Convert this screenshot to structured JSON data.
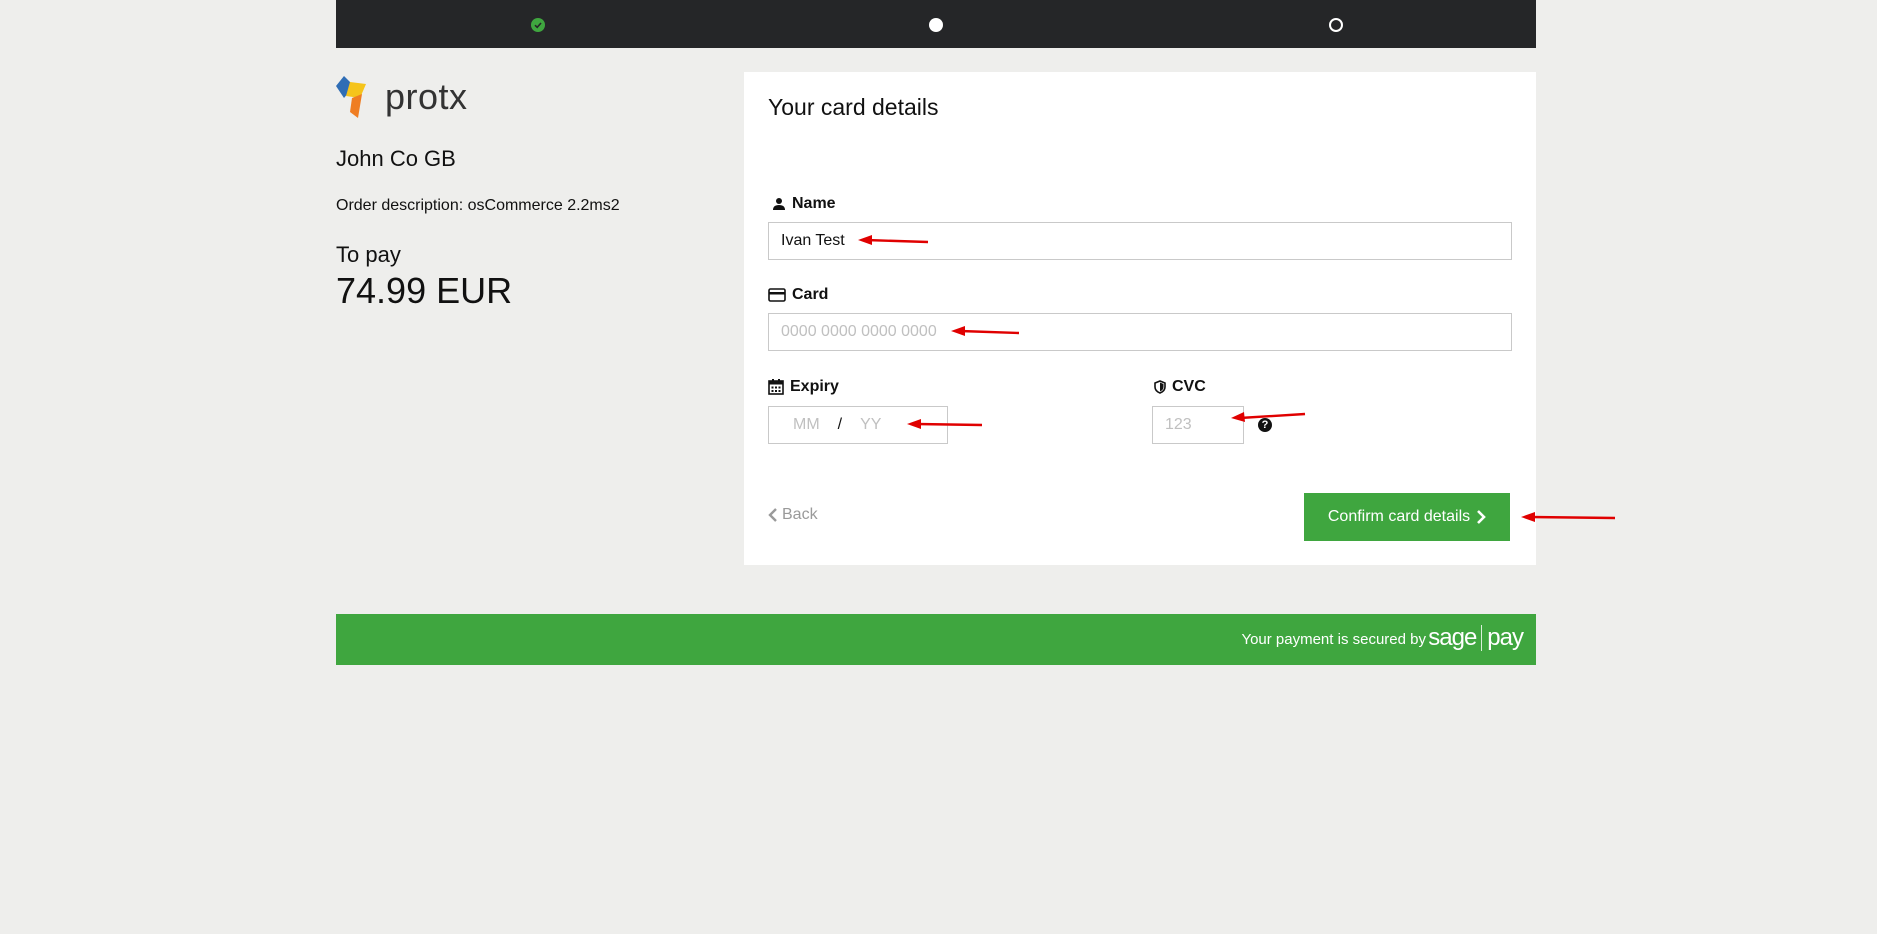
{
  "progress": {
    "steps": [
      {
        "state": "complete",
        "icon": "check-icon"
      },
      {
        "state": "current",
        "icon": "dot-filled-icon"
      },
      {
        "state": "upcoming",
        "icon": "dot-outline-icon"
      }
    ],
    "colors": {
      "complete": "#3fa63f",
      "bar": "#252628"
    }
  },
  "merchant": {
    "logo_text": "protx",
    "name": "John Co GB",
    "order_description": "Order description: osCommerce 2.2ms2",
    "to_pay_label": "To pay",
    "amount": "74.99 EUR"
  },
  "form": {
    "title": "Your card details",
    "name": {
      "label": "Name",
      "icon": "user-icon",
      "value": "Ivan Test"
    },
    "card": {
      "label": "Card",
      "icon": "credit-card-icon",
      "placeholder": "0000 0000 0000 0000"
    },
    "expiry": {
      "label": "Expiry",
      "icon": "calendar-icon",
      "month_placeholder": "MM",
      "separator": "/",
      "year_placeholder": "YY"
    },
    "cvc": {
      "label": "CVC",
      "icon": "shield-icon",
      "placeholder": "123",
      "help_icon": "question-icon"
    },
    "back_label": "Back",
    "confirm_label": "Confirm card details"
  },
  "footer": {
    "secured_text": "Your payment is secured by",
    "brand_left": "sage",
    "brand_right": "pay",
    "color": "#3fa63f"
  },
  "annotations": {
    "arrow_color": "#e00000"
  }
}
